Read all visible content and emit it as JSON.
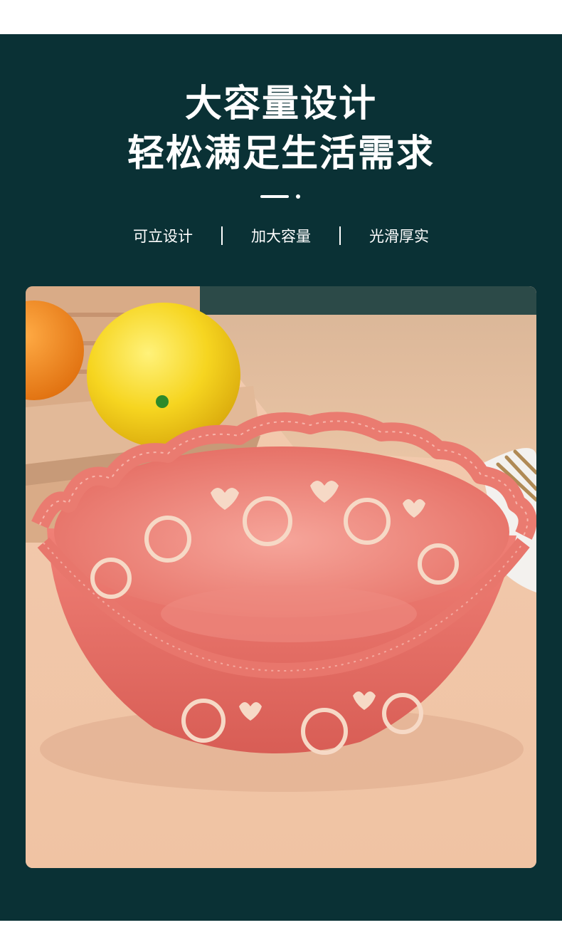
{
  "headline": {
    "line1": "大容量设计",
    "line2": "轻松满足生活需求"
  },
  "features": [
    "可立设计",
    "加大容量",
    "光滑厚实"
  ],
  "photo": {
    "subject": "pink-lace-fruit-bowl",
    "colors": {
      "background": "#0a3135",
      "table": "#f0c7a8",
      "bowl": "#e66f66",
      "lemon": "#f6d520",
      "orange": "#f08a1e"
    }
  }
}
